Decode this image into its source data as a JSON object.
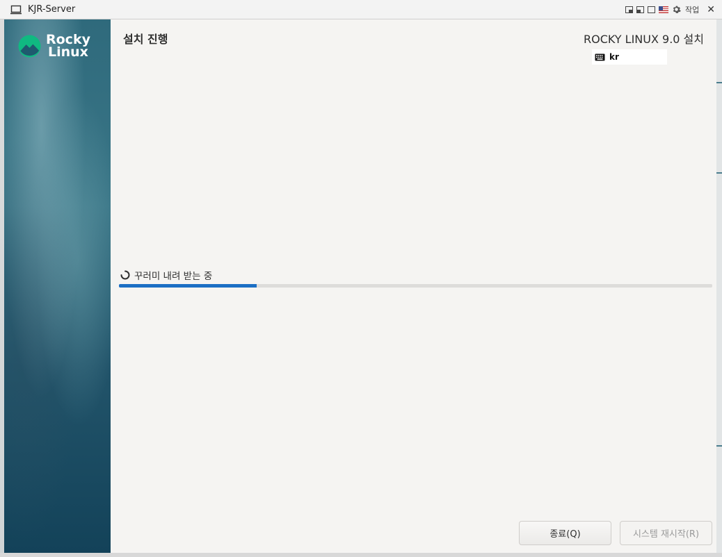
{
  "window": {
    "title": "KJR-Server",
    "task_label": "작업",
    "icons": [
      "computer-icon",
      "restore-icon",
      "tile-icon",
      "maximize-icon",
      "us-flag-icon",
      "gear-icon",
      "close-icon"
    ]
  },
  "installer": {
    "page_title": "설치 진행",
    "product_title": "ROCKY LINUX 9.0 설치",
    "keyboard_layout": "kr",
    "logo": {
      "line1": "Rocky",
      "line2": "Linux"
    },
    "status_text": "꾸러미 내려 받는 중",
    "progress_fraction": 0.232,
    "buttons": {
      "quit": "종료(Q)",
      "reboot": "시스템 재시작(R)"
    },
    "colors": {
      "accent": "#1c6fc4",
      "logo_green": "#10b981"
    }
  }
}
